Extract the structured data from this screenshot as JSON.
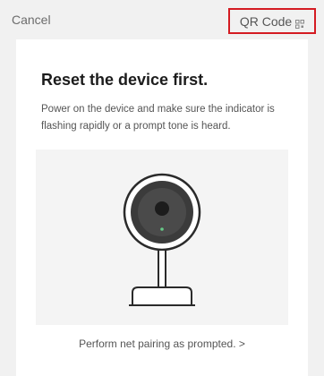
{
  "nav": {
    "cancel_label": "Cancel",
    "qr_label": "QR Code"
  },
  "content": {
    "title": "Reset the device first.",
    "description": "Power on the device and make sure the indicator is flashing rapidly or a prompt tone is heard.",
    "link_label": "Perform net pairing as prompted. >"
  },
  "icons": {
    "qr_icon": "qr-code-icon",
    "camera": "smart-camera-illustration"
  },
  "colors": {
    "highlight_border": "#d41b22",
    "background": "#f1f1f1",
    "card": "#ffffff"
  }
}
